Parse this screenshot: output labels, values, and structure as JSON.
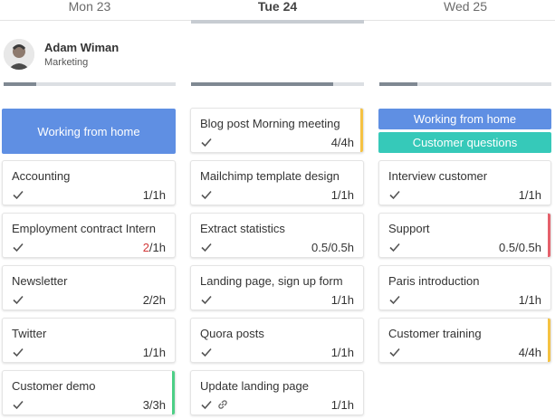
{
  "days": [
    {
      "label": "Mon 23",
      "active": false
    },
    {
      "label": "Tue 24",
      "active": true
    },
    {
      "label": "Wed 25",
      "active": false
    }
  ],
  "user": {
    "name": "Adam Wiman",
    "department": "Marketing"
  },
  "progress": [
    0.19,
    0.82,
    0.22
  ],
  "banners": {
    "mon": [
      "Working from home"
    ],
    "wed": [
      "Working from home",
      "Customer questions"
    ]
  },
  "colors": {
    "blue": "#5f8fe3",
    "teal": "#36c9b9",
    "yellow": "#f5c242",
    "red": "#e5606b",
    "green": "#4dcf86"
  },
  "tasks": {
    "mon": [
      {
        "title": "Accounting",
        "done": "1",
        "total": "/1h",
        "over": false,
        "accent": ""
      },
      {
        "title": "Employment contract Intern",
        "done": "2",
        "total": "/1h",
        "over": true,
        "accent": ""
      },
      {
        "title": "Newsletter",
        "done": "2",
        "total": "/2h",
        "over": false,
        "accent": ""
      },
      {
        "title": "Twitter",
        "done": "1",
        "total": "/1h",
        "over": false,
        "accent": ""
      },
      {
        "title": "Customer demo",
        "done": "3",
        "total": "/3h",
        "over": false,
        "accent": "green"
      }
    ],
    "tue": [
      {
        "title": "Blog post Morning meeting",
        "done": "4",
        "total": "/4h",
        "over": false,
        "accent": "yellow"
      },
      {
        "title": "Mailchimp template design",
        "done": "1",
        "total": "/1h",
        "over": false,
        "accent": ""
      },
      {
        "title": "Extract statistics",
        "done": "0.5",
        "total": "/0.5h",
        "over": false,
        "accent": ""
      },
      {
        "title": "Landing page, sign up form",
        "done": "1",
        "total": "/1h",
        "over": false,
        "accent": ""
      },
      {
        "title": "Quora posts",
        "done": "1",
        "total": "/1h",
        "over": false,
        "accent": ""
      },
      {
        "title": "Update landing page",
        "done": "1",
        "total": "/1h",
        "over": false,
        "accent": "",
        "link": true
      }
    ],
    "wed": [
      {
        "title": "Interview customer",
        "done": "1",
        "total": "/1h",
        "over": false,
        "accent": ""
      },
      {
        "title": "Support",
        "done": "0.5",
        "total": "/0.5h",
        "over": false,
        "accent": "red"
      },
      {
        "title": "Paris introduction",
        "done": "1",
        "total": "/1h",
        "over": false,
        "accent": ""
      },
      {
        "title": "Customer training",
        "done": "4",
        "total": "/4h",
        "over": false,
        "accent": "yellow"
      }
    ]
  }
}
